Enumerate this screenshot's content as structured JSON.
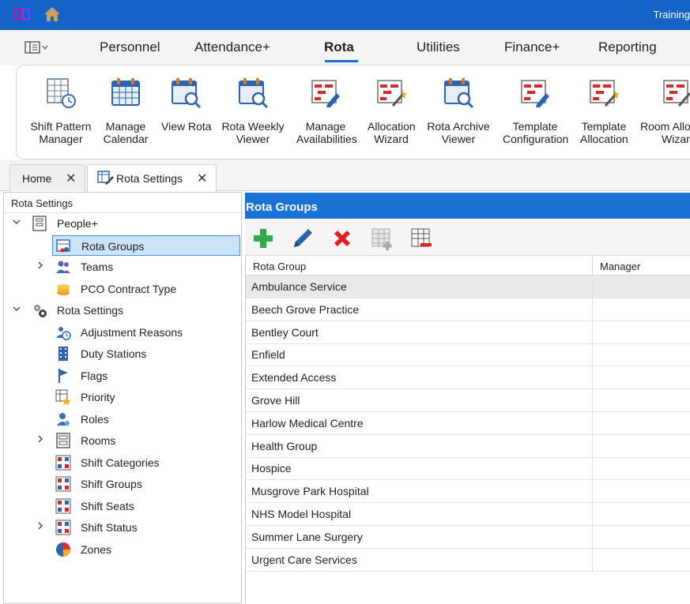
{
  "app": {
    "title": "Training"
  },
  "ribbon": {
    "tabs": [
      {
        "label": "Personnel"
      },
      {
        "label": "Attendance+"
      },
      {
        "label": "Rota",
        "active": true
      },
      {
        "label": "Utilities"
      },
      {
        "label": "Finance+"
      },
      {
        "label": "Reporting"
      }
    ],
    "buttons": [
      {
        "line1": "Shift Pattern",
        "line2": "Manager",
        "icon": "shift-pattern-icon"
      },
      {
        "line1": "Manage",
        "line2": "Calendar",
        "icon": "calendar-icon"
      },
      {
        "line1": "View Rota",
        "line2": "",
        "icon": "view-rota-icon"
      },
      {
        "line1": "Rota Weekly",
        "line2": "Viewer",
        "icon": "weekly-viewer-icon"
      },
      {
        "line1": "Manage",
        "line2": "Availabilities",
        "icon": "availabilities-icon"
      },
      {
        "line1": "Allocation",
        "line2": "Wizard",
        "icon": "allocation-wizard-icon"
      },
      {
        "line1": "Rota Archive",
        "line2": "Viewer",
        "icon": "archive-viewer-icon"
      },
      {
        "line1": "Template",
        "line2": "Configuration",
        "icon": "template-config-icon"
      },
      {
        "line1": "Template",
        "line2": "Allocation",
        "icon": "template-allocation-icon"
      },
      {
        "line1": "Room Alloc",
        "line2": "Wizard",
        "icon": "room-alloc-icon"
      }
    ]
  },
  "doc_tabs": [
    {
      "label": "Home",
      "close": "✕"
    },
    {
      "label": "Rota Settings",
      "close": "✕",
      "active": true
    }
  ],
  "tree": {
    "header": "Rota Settings",
    "nodes": [
      {
        "label": "People+",
        "level": 0,
        "expand": "down",
        "icon": "people-icon"
      },
      {
        "label": "Rota Groups",
        "level": 1,
        "expand": "",
        "icon": "rota-groups-icon",
        "selected": true
      },
      {
        "label": "Teams",
        "level": 1,
        "expand": "right",
        "icon": "teams-icon"
      },
      {
        "label": "PCO Contract Type",
        "level": 1,
        "expand": "",
        "icon": "coins-icon"
      },
      {
        "label": "Rota Settings",
        "level": 0,
        "expand": "down",
        "icon": "gears-icon"
      },
      {
        "label": "Adjustment Reasons",
        "level": 1,
        "expand": "",
        "icon": "adjustment-icon"
      },
      {
        "label": "Duty Stations",
        "level": 1,
        "expand": "",
        "icon": "building-icon"
      },
      {
        "label": "Flags",
        "level": 1,
        "expand": "",
        "icon": "flag-icon"
      },
      {
        "label": "Priority",
        "level": 1,
        "expand": "",
        "icon": "priority-star-icon"
      },
      {
        "label": "Roles",
        "level": 1,
        "expand": "",
        "icon": "roles-icon"
      },
      {
        "label": "Rooms",
        "level": 1,
        "expand": "right",
        "icon": "rooms-icon"
      },
      {
        "label": "Shift Categories",
        "level": 1,
        "expand": "",
        "icon": "shift-categories-icon"
      },
      {
        "label": "Shift Groups",
        "level": 1,
        "expand": "",
        "icon": "shift-groups-icon"
      },
      {
        "label": "Shift Seats",
        "level": 1,
        "expand": "",
        "icon": "shift-seats-icon"
      },
      {
        "label": "Shift Status",
        "level": 1,
        "expand": "right",
        "icon": "shift-status-icon"
      },
      {
        "label": "Zones",
        "level": 1,
        "expand": "",
        "icon": "zones-pie-icon"
      }
    ]
  },
  "grid": {
    "title": "Rota Groups",
    "toolbar": [
      "add-icon",
      "edit-icon",
      "delete-icon",
      "add-row-icon",
      "remove-row-icon"
    ],
    "columns": [
      "Rota Group",
      "Manager"
    ],
    "rows": [
      "Ambulance Service",
      "Beech Grove Practice",
      "Bentley Court",
      "Enfield",
      "Extended Access",
      "Grove Hill",
      "Harlow Medical Centre",
      "Health Group",
      "Hospice",
      "Musgrove Park Hospital",
      "NHS Model Hospital",
      "Summer Lane Surgery",
      "Urgent Care Services"
    ]
  },
  "colors": {
    "accent": "#1a72d6",
    "titlebar": "#1464c8",
    "selection": "#cce2f7",
    "add": "#2eaa4a",
    "delete": "#e02020"
  }
}
